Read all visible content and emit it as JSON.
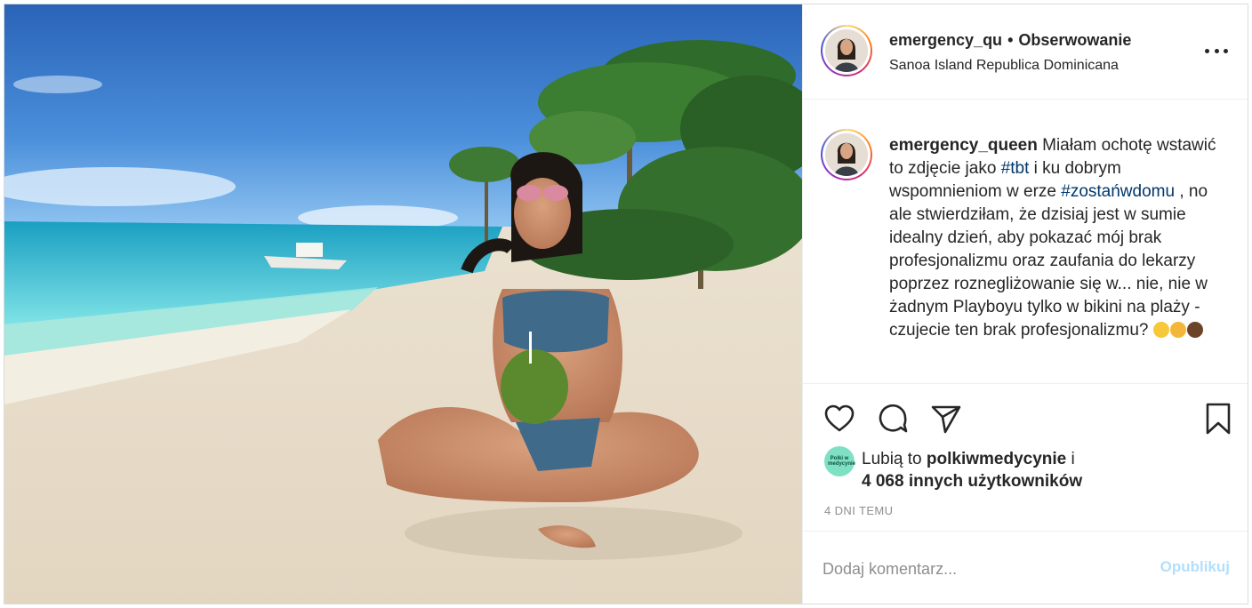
{
  "post": {
    "username": "emergency_qu",
    "separator": "•",
    "follow_status": "Obserwowanie",
    "location": "Sanoa Island Republica Dominicana"
  },
  "caption": {
    "username": "emergency_queen",
    "text_1": " Miałam ochotę wstawić to zdjęcie jako ",
    "tag_1": "#tbt",
    "text_2": " i ku dobrym wspomnieniom w erze ",
    "tag_2": "#zostańwdomu",
    "text_3": " , no ale stwierdziłam, że dzisiaj jest w sumie idealny dzień, aby pokazać mój brak profesjonalizmu oraz zaufania do lekarzy poprzez roznegliżowanie się w... nie, nie w żadnym Playboyu tylko w bikini na plaży - czujecie ten brak profesjonalizmu? "
  },
  "icons": {
    "more": "more-horizontal-icon",
    "like": "heart-icon",
    "comment": "comment-bubble-icon",
    "share": "paper-plane-icon",
    "save": "bookmark-icon",
    "caption_emojis": [
      "grimacing-emoji",
      "zany-face-emoji",
      "coconut-emoji"
    ]
  },
  "likes": {
    "prefix": "Lubią to ",
    "liker": "polkiwmedycynie",
    "conjunction": " i",
    "others": "4 068 innych użytkowników",
    "liker_avatar_text": "Polki w medycynie"
  },
  "timestamp": "4 DNI TEMU",
  "comment_box": {
    "placeholder": "Dodaj komentarz...",
    "publish_label": "Opublikuj"
  },
  "colors": {
    "link": "#00376b",
    "publish_disabled": "#b2dffc",
    "muted": "#8e8e8e",
    "border": "#dbdbdb"
  }
}
